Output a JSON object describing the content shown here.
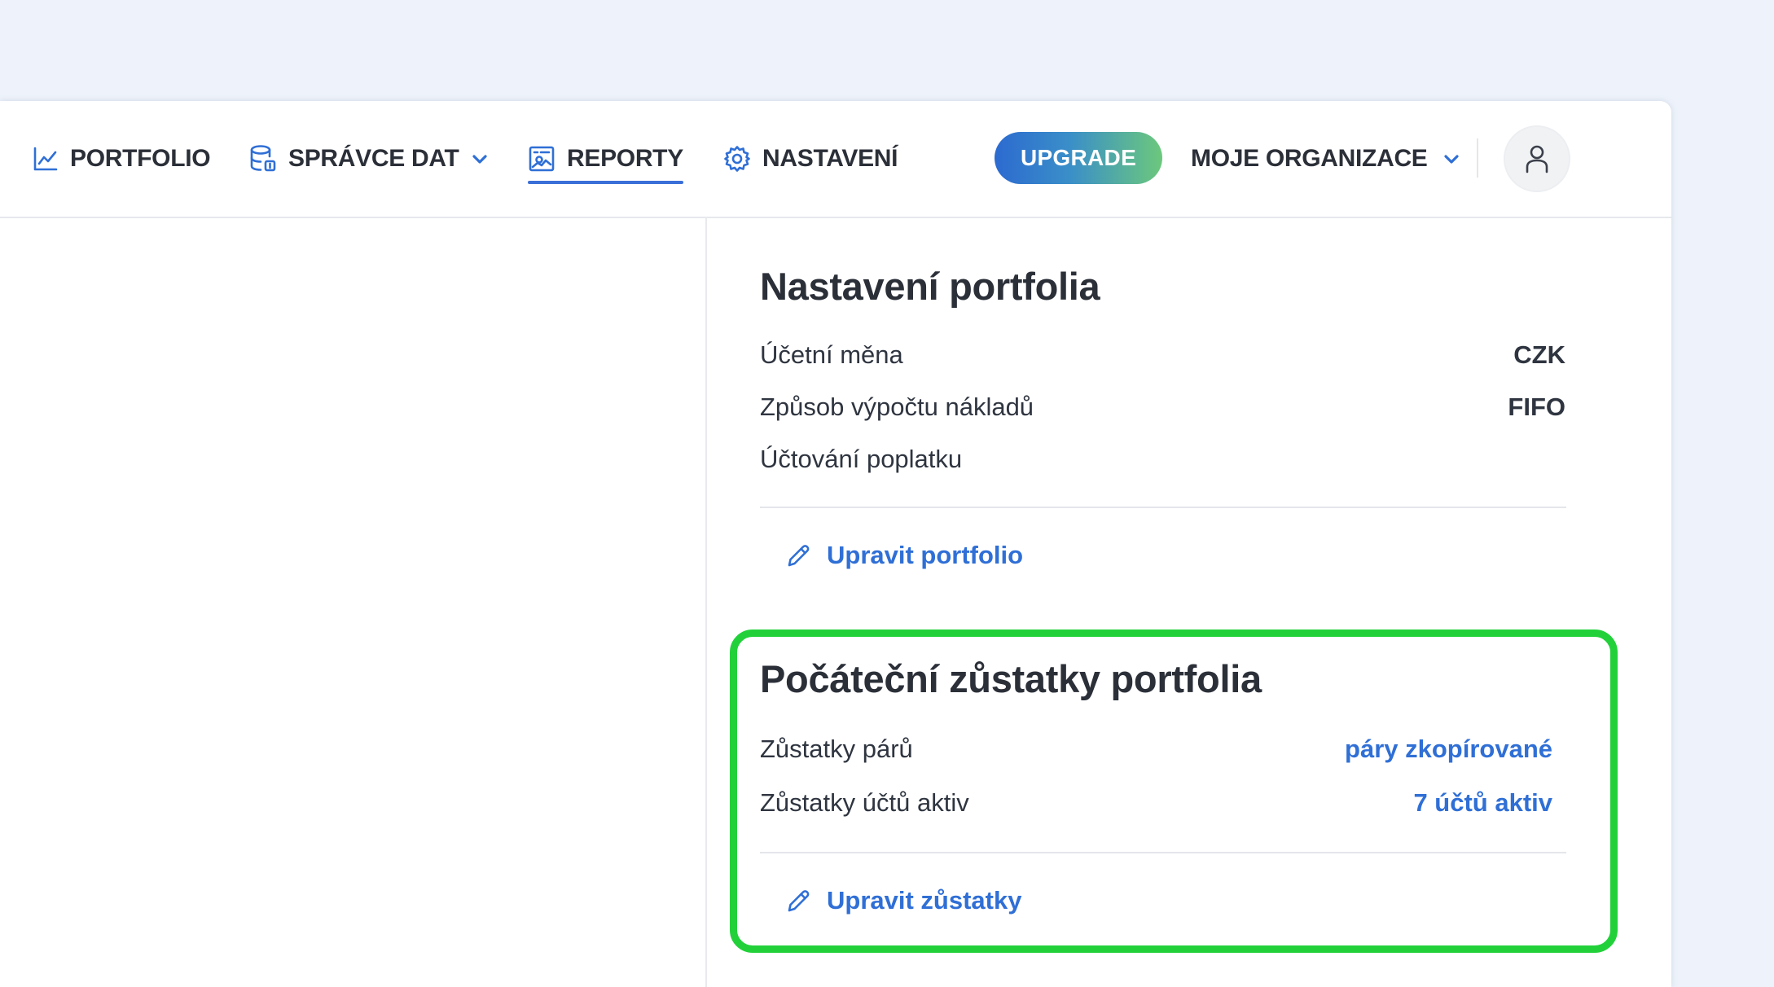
{
  "nav": {
    "portfolio_label": "PORTFOLIO",
    "spravce_label": "SPRÁVCE DAT",
    "reporty_label": "REPORTY",
    "nastaveni_label": "NASTAVENÍ",
    "upgrade_label": "UPGRADE",
    "org_label": "MOJE ORGANIZACE",
    "active_item": "REPORTY",
    "icons": {
      "portfolio": "line-chart-icon",
      "spravce": "database-icon",
      "reporty": "report-icon",
      "nastaveni": "gear-icon",
      "dropdown": "chevron-down-icon",
      "avatar": "user-icon"
    }
  },
  "portfolio_settings": {
    "title": "Nastavení portfolia",
    "rows": [
      {
        "label": "Účetní měna",
        "value": "CZK"
      },
      {
        "label": "Způsob výpočtu nákladů",
        "value": "FIFO"
      },
      {
        "label": "Účtování poplatku",
        "value": ""
      }
    ],
    "edit_label": "Upravit portfolio"
  },
  "initial_balances": {
    "title": "Počáteční zůstatky portfolia",
    "rows": [
      {
        "label": "Zůstatky párů",
        "value": "páry zkopírované"
      },
      {
        "label": "Zůstatky účtů aktiv",
        "value": "7 účtů aktiv"
      }
    ],
    "edit_label": "Upravit zůstatky"
  },
  "colors": {
    "accent": "#2f6fd6",
    "highlight": "#22d13a",
    "upgrade_gradient_start": "#2c6ad0",
    "upgrade_gradient_end": "#6cc87c",
    "background": "#eef3fb"
  }
}
